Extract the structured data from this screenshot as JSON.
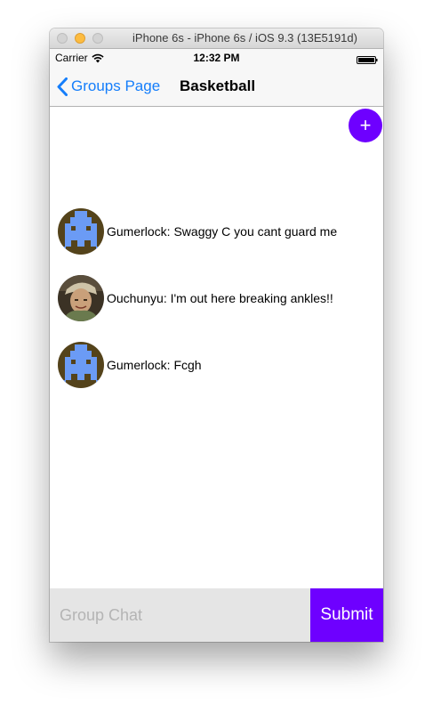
{
  "window": {
    "title": "iPhone 6s - iPhone 6s / iOS 9.3 (13E5191d)"
  },
  "status_bar": {
    "carrier": "Carrier",
    "time": "12:32 PM",
    "icons": [
      "wifi-icon",
      "battery-icon"
    ]
  },
  "nav": {
    "back_label": "Groups Page",
    "back_icon": "chevron-left-icon",
    "title": "Basketball"
  },
  "add_button": {
    "label": "+",
    "color": "#6e00ff"
  },
  "messages": [
    {
      "avatar": "pixel-invader-avatar",
      "text": "Gumerlock: Swaggy C you cant guard me"
    },
    {
      "avatar": "photo-avatar",
      "text": "Ouchunyu: I'm out here breaking ankles!!"
    },
    {
      "avatar": "pixel-invader-avatar",
      "text": "Gumerlock: Fcgh"
    }
  ],
  "composer": {
    "placeholder": "Group Chat",
    "value": "",
    "submit_label": "Submit"
  },
  "colors": {
    "accent": "#6e00ff",
    "ios_blue": "#157efb",
    "input_background": "#e5e5e5"
  }
}
